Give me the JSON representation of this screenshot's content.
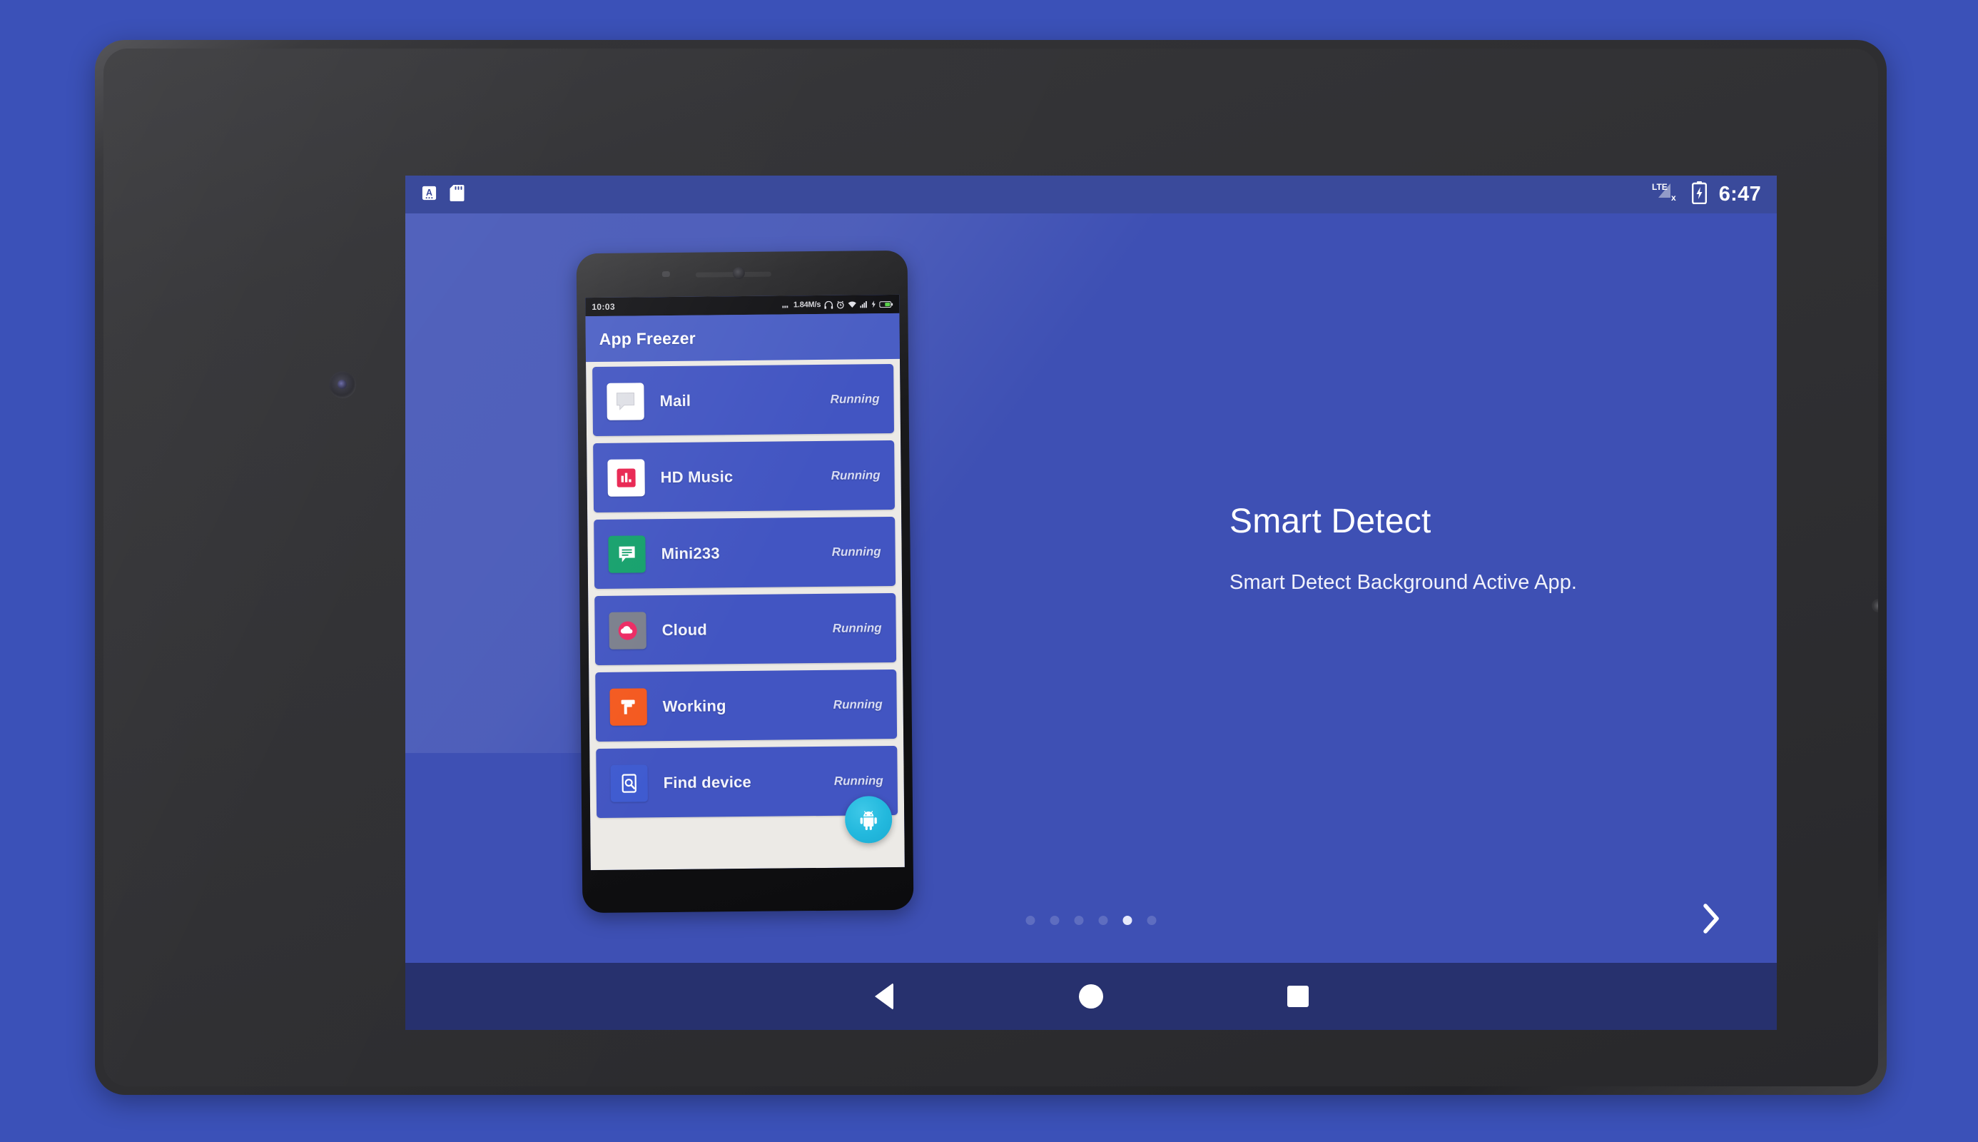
{
  "theme": {
    "page_bg": "#3b51b8",
    "screen_bg": "#3e50b4",
    "status_bar_bg": "#3a4a9b",
    "nav_bar_bg": "#27316e",
    "accent_fab": "#22b8dd",
    "bezel": "#2e2e31"
  },
  "tablet_status_bar": {
    "left_icons": [
      {
        "name": "screenshot-capture-icon",
        "label": "A"
      },
      {
        "name": "sd-card-icon",
        "label": "SD"
      }
    ],
    "right": {
      "signal_label": "LTE",
      "signal_state": "x",
      "battery": "charging",
      "clock": "6:47"
    }
  },
  "onboarding": {
    "title": "Smart Detect",
    "subtitle": "Smart Detect Background Active App.",
    "next_label": "›",
    "pager": {
      "total": 6,
      "active_index": 4
    }
  },
  "phone_mockup": {
    "status_bar": {
      "clock": "10:03",
      "net_speed": "1.84M/s",
      "icons": [
        "headset-icon",
        "alarm-icon",
        "wifi-icon",
        "signal-icon",
        "charging-icon",
        "battery-icon"
      ]
    },
    "app_bar": {
      "title": "App Freezer"
    },
    "fab": {
      "icon": "android-robot-icon"
    },
    "apps": [
      {
        "name": "Mail",
        "status": "Running",
        "icon": "chat-bubble-icon",
        "icon_bg": "#ffffff",
        "glyph_color": "#e9eaee"
      },
      {
        "name": "HD Music",
        "status": "Running",
        "icon": "equalizer-icon",
        "icon_bg": "#ffffff",
        "glyph_color": "#e8234f"
      },
      {
        "name": "Mini233",
        "status": "Running",
        "icon": "message-lines-icon",
        "icon_bg": "#14a06b",
        "glyph_color": "#ffffff"
      },
      {
        "name": "Cloud",
        "status": "Running",
        "icon": "cloud-icon",
        "icon_bg": "#7b7f8c",
        "glyph_color": "#ffffff"
      },
      {
        "name": "Working",
        "status": "Running",
        "icon": "paint-roller-icon",
        "icon_bg": "#f4591f",
        "glyph_color": "#ffffff"
      },
      {
        "name": "Find device",
        "status": "Running",
        "icon": "device-search-icon",
        "icon_bg": "#3f5bd0",
        "glyph_color": "#ffffff"
      }
    ]
  },
  "nav_bar": {
    "buttons": [
      {
        "name": "back-button",
        "icon": "triangle-back-icon"
      },
      {
        "name": "home-button",
        "icon": "circle-home-icon"
      },
      {
        "name": "recents-button",
        "icon": "square-recents-icon"
      }
    ]
  }
}
